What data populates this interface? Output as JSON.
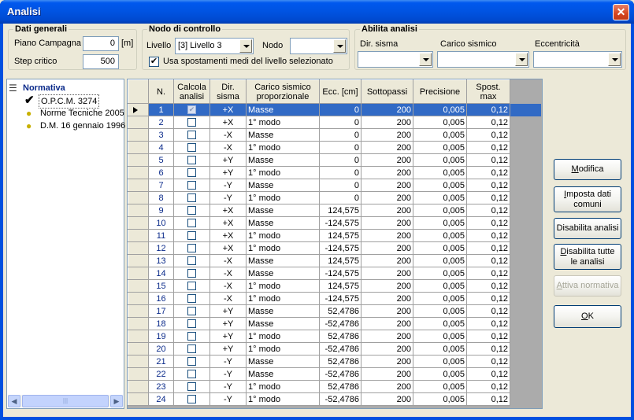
{
  "window": {
    "title": "Analisi",
    "close_glyph": "✕"
  },
  "dati_generali": {
    "legend": "Dati generali",
    "piano_label": "Piano Campagna",
    "piano_value": "0",
    "piano_unit": "[m]",
    "step_label": "Step critico",
    "step_value": "500"
  },
  "nodo": {
    "legend": "Nodo di controllo",
    "livello_label": "Livello",
    "livello_value": "[3]   Livello 3",
    "nodo_label": "Nodo",
    "nodo_value": "",
    "check_label": "Usa spostamenti medi del livello selezionato",
    "check_checked": true
  },
  "abilita": {
    "legend": "Abilita analisi",
    "dir_label": "Dir. sisma",
    "carico_label": "Carico sismico",
    "ecc_label": "Eccentricità"
  },
  "tree": {
    "root": "Normativa",
    "items": [
      {
        "label": "O.P.C.M. 3274",
        "icon": "check-icon",
        "selected": true
      },
      {
        "label": "Norme Tecniche 2005",
        "icon": "lightbulb-icon",
        "selected": false
      },
      {
        "label": "D.M. 16 gennaio 1996",
        "icon": "lightbulb-icon",
        "selected": false
      }
    ]
  },
  "grid": {
    "headers": [
      "N.",
      "Calcola analisi",
      "Dir. sisma",
      "Carico sismico proporzionale",
      "Ecc. [cm]",
      "Sottopassi",
      "Precisione",
      "Spost. max"
    ],
    "rows": [
      [
        "1",
        true,
        "+X",
        "Masse",
        "0",
        "200",
        "0,005",
        "0,12"
      ],
      [
        "2",
        false,
        "+X",
        "1° modo",
        "0",
        "200",
        "0,005",
        "0,12"
      ],
      [
        "3",
        false,
        "-X",
        "Masse",
        "0",
        "200",
        "0,005",
        "0,12"
      ],
      [
        "4",
        false,
        "-X",
        "1° modo",
        "0",
        "200",
        "0,005",
        "0,12"
      ],
      [
        "5",
        false,
        "+Y",
        "Masse",
        "0",
        "200",
        "0,005",
        "0,12"
      ],
      [
        "6",
        false,
        "+Y",
        "1° modo",
        "0",
        "200",
        "0,005",
        "0,12"
      ],
      [
        "7",
        false,
        "-Y",
        "Masse",
        "0",
        "200",
        "0,005",
        "0,12"
      ],
      [
        "8",
        false,
        "-Y",
        "1° modo",
        "0",
        "200",
        "0,005",
        "0,12"
      ],
      [
        "9",
        false,
        "+X",
        "Masse",
        "124,575",
        "200",
        "0,005",
        "0,12"
      ],
      [
        "10",
        false,
        "+X",
        "Masse",
        "-124,575",
        "200",
        "0,005",
        "0,12"
      ],
      [
        "11",
        false,
        "+X",
        "1° modo",
        "124,575",
        "200",
        "0,005",
        "0,12"
      ],
      [
        "12",
        false,
        "+X",
        "1° modo",
        "-124,575",
        "200",
        "0,005",
        "0,12"
      ],
      [
        "13",
        false,
        "-X",
        "Masse",
        "124,575",
        "200",
        "0,005",
        "0,12"
      ],
      [
        "14",
        false,
        "-X",
        "Masse",
        "-124,575",
        "200",
        "0,005",
        "0,12"
      ],
      [
        "15",
        false,
        "-X",
        "1° modo",
        "124,575",
        "200",
        "0,005",
        "0,12"
      ],
      [
        "16",
        false,
        "-X",
        "1° modo",
        "-124,575",
        "200",
        "0,005",
        "0,12"
      ],
      [
        "17",
        false,
        "+Y",
        "Masse",
        "52,4786",
        "200",
        "0,005",
        "0,12"
      ],
      [
        "18",
        false,
        "+Y",
        "Masse",
        "-52,4786",
        "200",
        "0,005",
        "0,12"
      ],
      [
        "19",
        false,
        "+Y",
        "1° modo",
        "52,4786",
        "200",
        "0,005",
        "0,12"
      ],
      [
        "20",
        false,
        "+Y",
        "1° modo",
        "-52,4786",
        "200",
        "0,005",
        "0,12"
      ],
      [
        "21",
        false,
        "-Y",
        "Masse",
        "52,4786",
        "200",
        "0,005",
        "0,12"
      ],
      [
        "22",
        false,
        "-Y",
        "Masse",
        "-52,4786",
        "200",
        "0,005",
        "0,12"
      ],
      [
        "23",
        false,
        "-Y",
        "1° modo",
        "52,4786",
        "200",
        "0,005",
        "0,12"
      ],
      [
        "24",
        false,
        "-Y",
        "1° modo",
        "-52,4786",
        "200",
        "0,005",
        "0,12"
      ]
    ],
    "selected_row": 0
  },
  "buttons": {
    "modifica": {
      "u": "M",
      "rest": "odifica"
    },
    "imposta": {
      "u": "I",
      "rest": "mposta dati comuni"
    },
    "disabilita": {
      "u": "",
      "rest": "Disabilita analisi"
    },
    "disabilita_tutte": {
      "u": "D",
      "rest": "isabilita tutte le analisi"
    },
    "attiva": {
      "u": "A",
      "rest": "ttiva normativa"
    },
    "ok": {
      "u": "O",
      "rest": "K"
    }
  },
  "colors": {
    "title_bar": "#0054e3",
    "selection": "#316ac5",
    "row_number": "#0a2a8a"
  }
}
